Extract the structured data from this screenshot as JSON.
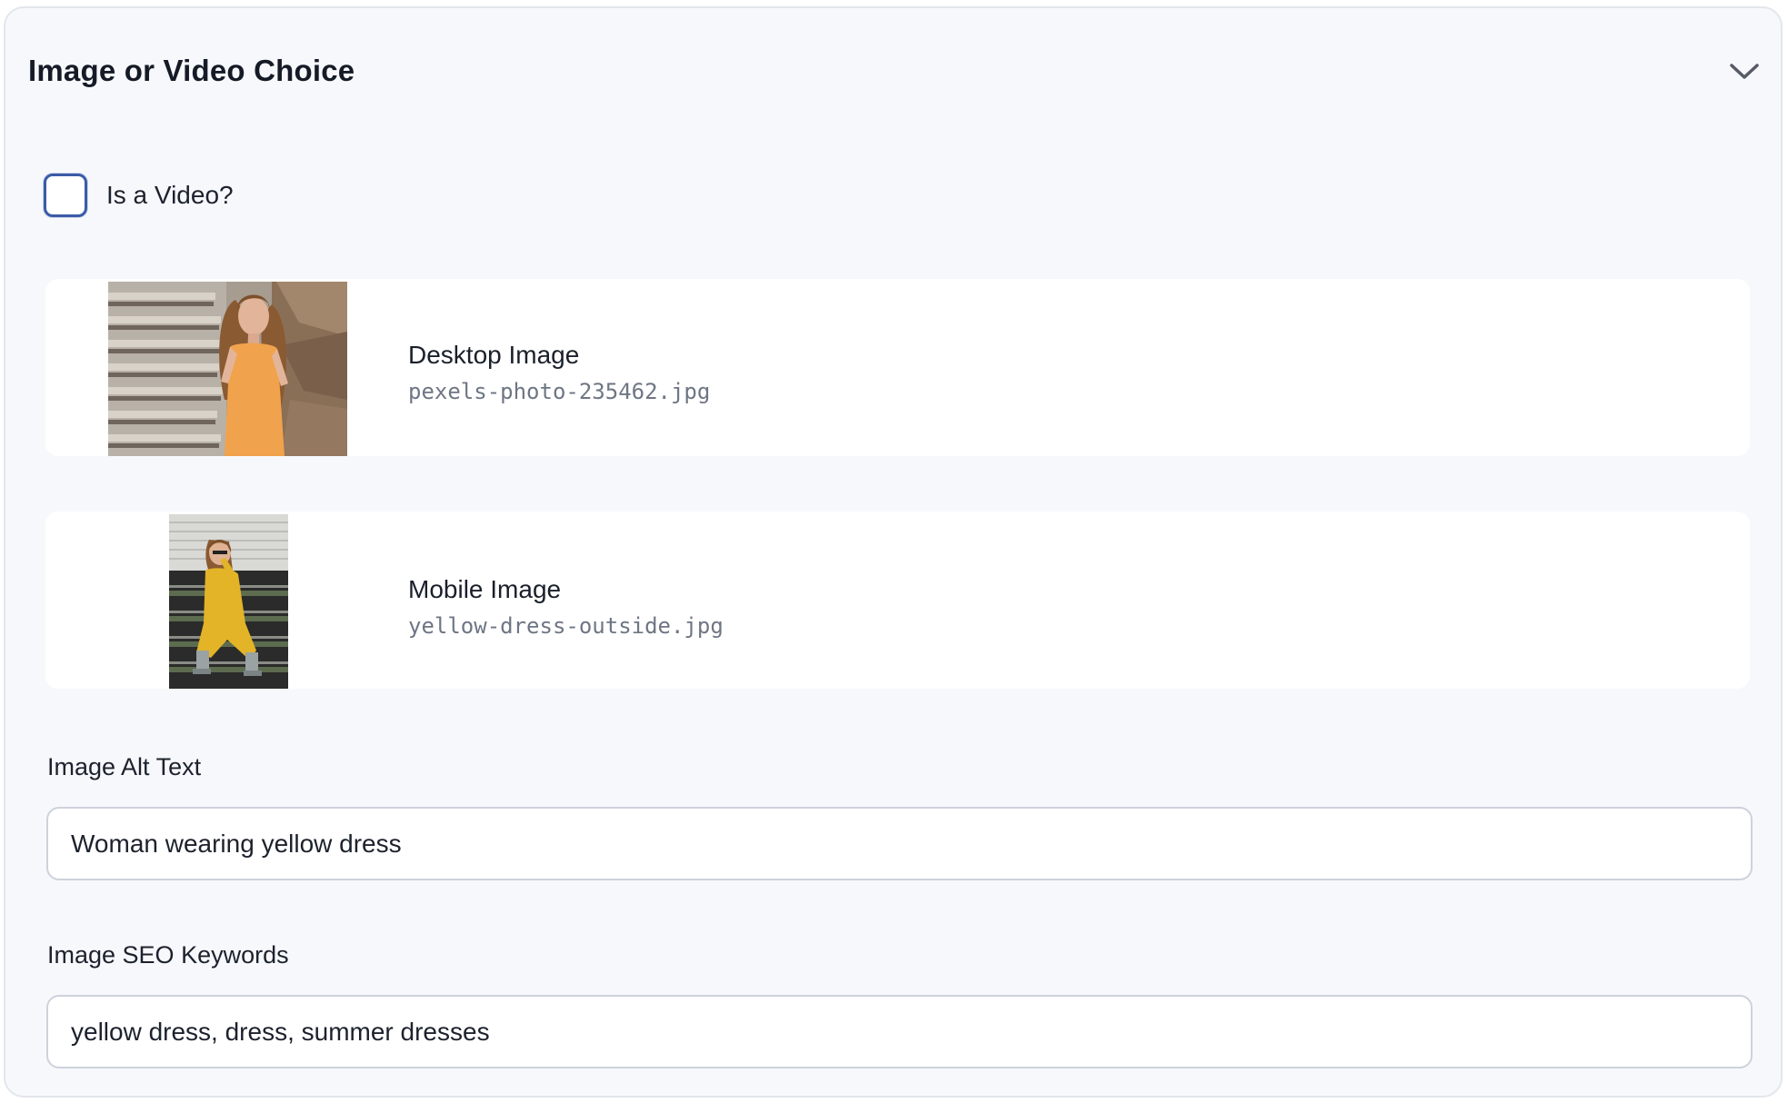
{
  "panel": {
    "title": "Image or Video Choice",
    "collapse_icon": "chevron-down-icon"
  },
  "video_toggle": {
    "label": "Is a Video?",
    "checked": false
  },
  "desktop_image": {
    "title": "Desktop Image",
    "filename": "pexels-photo-235462.jpg"
  },
  "mobile_image": {
    "title": "Mobile Image",
    "filename": "yellow-dress-outside.jpg"
  },
  "alt_text": {
    "label": "Image Alt Text",
    "value": "Woman wearing yellow dress"
  },
  "seo_keywords": {
    "label": "Image SEO Keywords",
    "value": "yellow dress, dress, summer dresses"
  },
  "colors": {
    "panel_background": "#f7f8fc",
    "card_background": "#ffffff",
    "checkbox_border": "#3b5ba7",
    "input_border": "#cdd2db",
    "text_primary": "#1c222d",
    "text_secondary": "#6e7684"
  }
}
